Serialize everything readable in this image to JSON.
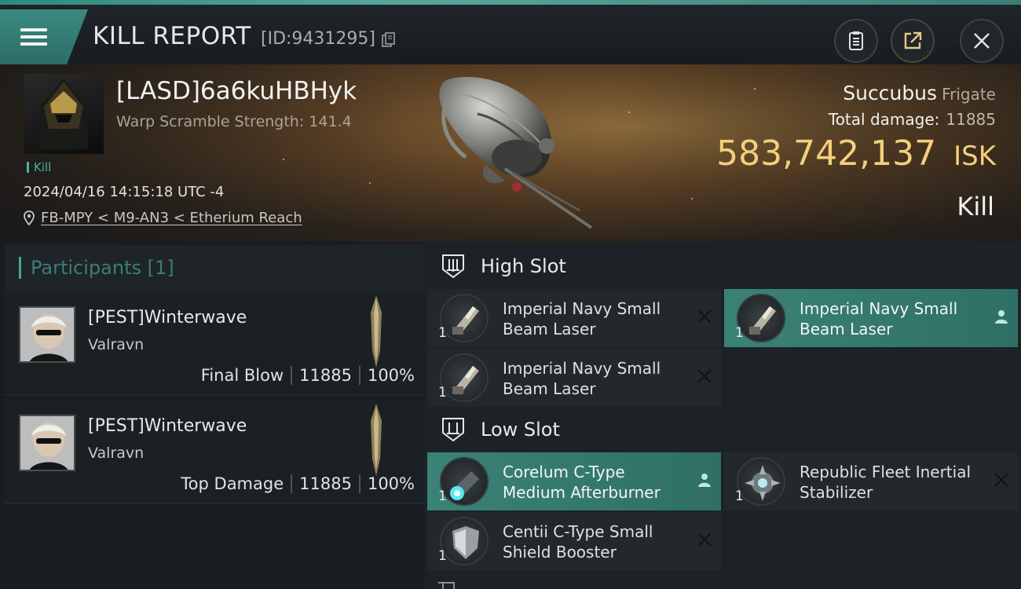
{
  "header": {
    "title": "KILL REPORT",
    "report_id": "[ID:9431295]",
    "icons": [
      "menu-icon",
      "copy-icon",
      "clipboard-icon",
      "share-icon",
      "close-icon"
    ]
  },
  "victim": {
    "name": "[LASD]6a6kuHBHyk",
    "warp_scramble": "Warp Scramble Strength: 141.4",
    "tag": "Kill",
    "datetime": "2024/04/16 14:15:18 UTC -4",
    "location": "FB-MPY < M9-AN3 < Etherium Reach",
    "ship_name": "Succubus",
    "ship_class": "Frigate",
    "total_damage_label": "Total damage:",
    "total_damage": "11885",
    "isk_value": "583,742,137",
    "isk_unit": "ISK",
    "result": "Kill"
  },
  "participants": {
    "label": "Participants",
    "count": "[1]",
    "items": [
      {
        "name": "[PEST]Winterwave",
        "corp": "Valravn",
        "role": "Final Blow",
        "damage": "11885",
        "percent": "100%"
      },
      {
        "name": "[PEST]Winterwave",
        "corp": "Valravn",
        "role": "Top Damage",
        "damage": "11885",
        "percent": "100%"
      }
    ]
  },
  "slots": {
    "high": {
      "label": "High Slot",
      "modules": [
        {
          "name": "Imperial Navy Small Beam Laser",
          "qty": "1",
          "state": "destroyed"
        },
        {
          "name": "Imperial Navy Small Beam Laser",
          "qty": "1",
          "state": "dropped"
        },
        {
          "name": "Imperial Navy Small Beam Laser",
          "qty": "1",
          "state": "destroyed"
        }
      ]
    },
    "low": {
      "label": "Low Slot",
      "modules": [
        {
          "name": "Corelum C-Type Medium Afterburner",
          "qty": "1",
          "state": "dropped"
        },
        {
          "name": "Republic Fleet Inertial Stabilizer",
          "qty": "1",
          "state": "destroyed"
        },
        {
          "name": "Centii C-Type Small Shield Booster",
          "qty": "1",
          "state": "destroyed"
        }
      ]
    }
  },
  "colors": {
    "accent": "#3a8276",
    "isk": "#f4cf7c",
    "kill_tag": "#49b2a4"
  }
}
